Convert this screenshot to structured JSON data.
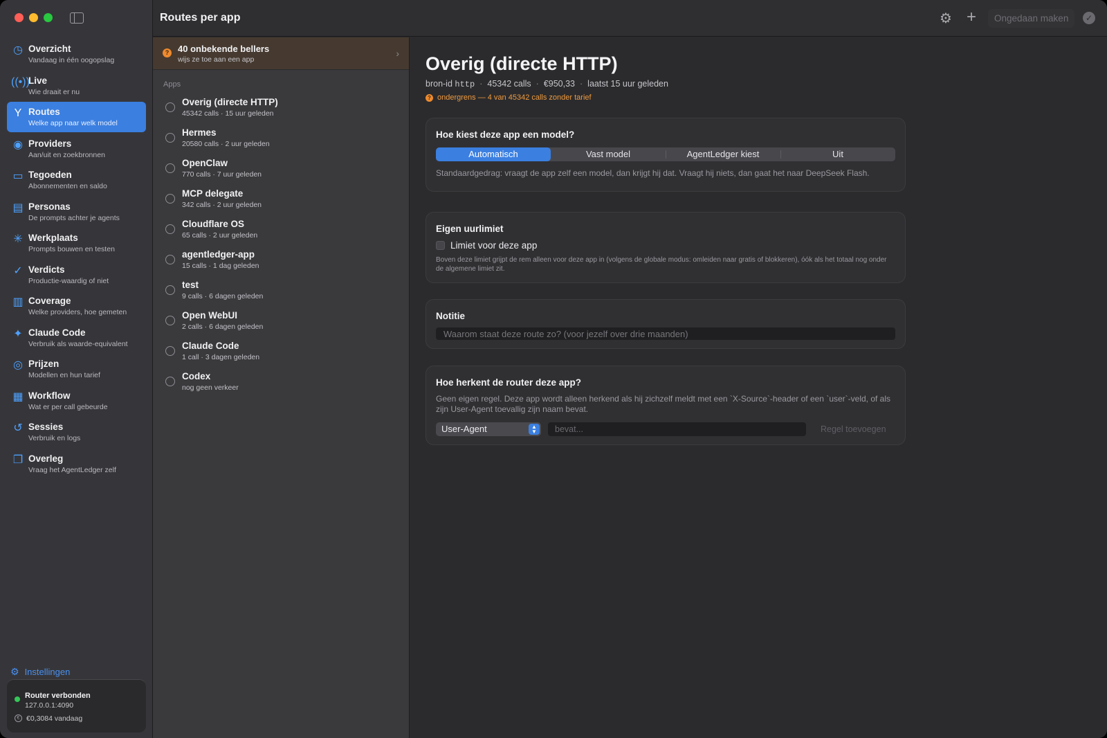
{
  "toolbar": {
    "title": "Routes per app",
    "undo_label": "Ongedaan maken",
    "icons": {
      "settings": "gear-icon",
      "add": "plus-icon",
      "confirm": "checkmark-icon"
    }
  },
  "sidebar": {
    "items": [
      {
        "title": "Overzicht",
        "sub": "Vandaag in één oogopslag",
        "icon": "◷"
      },
      {
        "title": "Live",
        "sub": "Wie draait er nu",
        "icon": "((•))"
      },
      {
        "title": "Routes",
        "sub": "Welke app naar welk model",
        "icon": "Y"
      },
      {
        "title": "Providers",
        "sub": "Aan/uit en zoekbronnen",
        "icon": "◉"
      },
      {
        "title": "Tegoeden",
        "sub": "Abonnementen en saldo",
        "icon": "▭"
      },
      {
        "title": "Personas",
        "sub": "De prompts achter je agents",
        "icon": "▤"
      },
      {
        "title": "Werkplaats",
        "sub": "Prompts bouwen en testen",
        "icon": "✳"
      },
      {
        "title": "Verdicts",
        "sub": "Productie-waardig of niet",
        "icon": "✓"
      },
      {
        "title": "Coverage",
        "sub": "Welke providers, hoe gemeten",
        "icon": "▥"
      },
      {
        "title": "Claude Code",
        "sub": "Verbruik als waarde-equivalent",
        "icon": "✦"
      },
      {
        "title": "Prijzen",
        "sub": "Modellen en hun tarief",
        "icon": "◎"
      },
      {
        "title": "Workflow",
        "sub": "Wat er per call gebeurde",
        "icon": "▦"
      },
      {
        "title": "Sessies",
        "sub": "Verbruik en logs",
        "icon": "↺"
      },
      {
        "title": "Overleg",
        "sub": "Vraag het AgentLedger zelf",
        "icon": "❐"
      }
    ],
    "settings_label": "Instellingen",
    "status": {
      "title": "Router verbonden",
      "address": "127.0.0.1:4090",
      "cost": "€0,3084 vandaag"
    }
  },
  "list": {
    "banner": {
      "title": "40 onbekende bellers",
      "sub": "wijs ze toe aan een app"
    },
    "section_label": "Apps",
    "apps": [
      {
        "name": "Overig (directe HTTP)",
        "meta": "45342 calls · 15 uur geleden"
      },
      {
        "name": "Hermes",
        "meta": "20580 calls · 2 uur geleden"
      },
      {
        "name": "OpenClaw",
        "meta": "770 calls · 7 uur geleden"
      },
      {
        "name": "MCP delegate",
        "meta": "342 calls · 2 uur geleden"
      },
      {
        "name": "Cloudflare OS",
        "meta": "65 calls · 2 uur geleden"
      },
      {
        "name": "agentledger-app",
        "meta": "15 calls · 1 dag geleden"
      },
      {
        "name": "test",
        "meta": "9 calls · 6 dagen geleden"
      },
      {
        "name": "Open WebUI",
        "meta": "2 calls · 6 dagen geleden"
      },
      {
        "name": "Claude Code",
        "meta": "1 call · 3 dagen geleden"
      },
      {
        "name": "Codex",
        "meta": "nog geen verkeer"
      }
    ]
  },
  "detail": {
    "title": "Overig (directe HTTP)",
    "meta": {
      "source_label": "bron-id",
      "source_id": "http",
      "calls": "45342 calls",
      "cost": "€950,33",
      "last": "laatst 15 uur geleden"
    },
    "warning": "ondergrens — 4 van 45342 calls zonder tarief",
    "model_card": {
      "title": "Hoe kiest deze app een model?",
      "options": [
        "Automatisch",
        "Vast model",
        "AgentLedger kiest",
        "Uit"
      ],
      "selected": "Automatisch",
      "description": "Standaardgedrag: vraagt de app zelf een model, dan krijgt hij dat. Vraagt hij niets, dan gaat het naar DeepSeek Flash."
    },
    "limit_card": {
      "title": "Eigen uurlimiet",
      "checkbox_label": "Limiet voor deze app",
      "checked": false,
      "description": "Boven deze limiet grijpt de rem alleen voor deze app in (volgens de globale modus: omleiden naar gratis of blokkeren), óók als het totaal nog onder de algemene limiet zit."
    },
    "note_card": {
      "title": "Notitie",
      "placeholder": "Waarom staat deze route zo? (voor jezelf over drie maanden)",
      "value": ""
    },
    "router_card": {
      "title": "Hoe herkent de router deze app?",
      "description": "Geen eigen regel. Deze app wordt alleen herkend als hij zichzelf meldt met een `X-Source`-header of een `user`-veld, of als zijn User-Agent toevallig zijn naam bevat.",
      "match_field": "User-Agent",
      "rule_placeholder": "bevat...",
      "add_rule_label": "Regel toevoegen"
    }
  },
  "colors": {
    "accent": "#3b7fe0",
    "warning": "#ee8a2d",
    "connected": "#35c759"
  }
}
